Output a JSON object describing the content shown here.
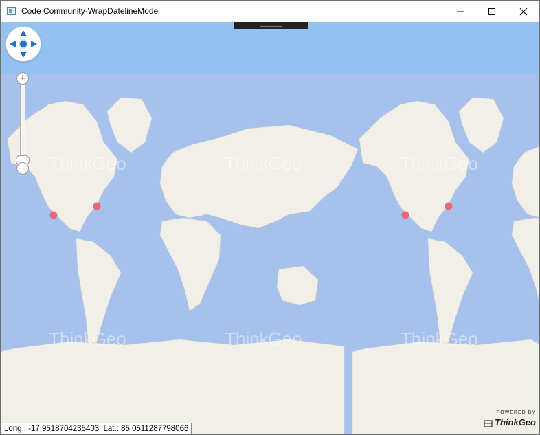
{
  "window": {
    "title": "Code Community-WrapDatelineMode",
    "icon": "app-window-icon",
    "controls": [
      "minimize-icon",
      "maximize-icon",
      "close-icon"
    ]
  },
  "map": {
    "watermark_text": "ThinkGeo",
    "colors": {
      "ocean": "#a5c1ec",
      "land": "#f1efe8",
      "marker": "#ef5a6a"
    },
    "markers": [
      "Los Angeles",
      "New York",
      "Los Angeles (wrapped)",
      "New York (wrapped)"
    ],
    "pan_control": {
      "icons": [
        "pan-up-icon",
        "pan-down-icon",
        "pan-left-icon",
        "pan-right-icon",
        "pan-center-icon"
      ]
    },
    "zoom_control": {
      "plus": "+",
      "minus": "−"
    }
  },
  "status": {
    "coordinates": "Long.: -17.9518704235403  Lat.: 85.0511287798066"
  },
  "attribution": {
    "powered_by": "POWERED BY",
    "brand": "ThinkGeo"
  }
}
